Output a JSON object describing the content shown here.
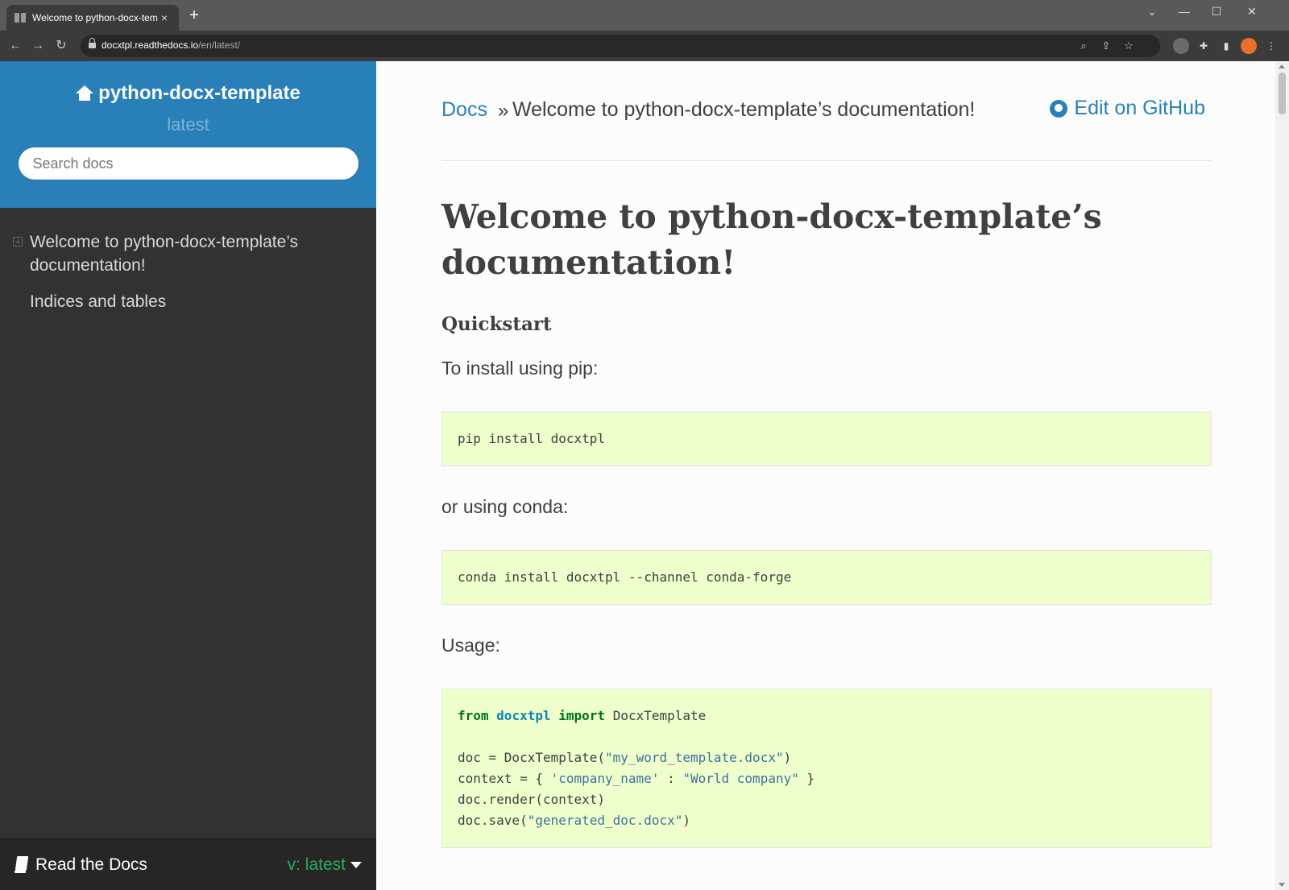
{
  "browser": {
    "tab_title": "Welcome to python-docx-templ",
    "tab_close": "×",
    "new_tab": "+",
    "url_domain": "docxtpl.readthedocs.io",
    "url_path": "/en/latest/",
    "controls": {
      "minimize": "—",
      "maximize": "☐",
      "close": "✕",
      "chevron": "⌄"
    },
    "nav": {
      "back": "←",
      "forward": "→",
      "reload": "↻"
    }
  },
  "sidebar": {
    "project_title": "python-docx-template",
    "version": "latest",
    "search_placeholder": "Search docs",
    "toc": [
      {
        "label": "Welcome to python-docx-template’s documentation!"
      },
      {
        "label": "Indices and tables"
      }
    ],
    "rtd_label": "Read the Docs",
    "rtd_version": "v: latest"
  },
  "breadcrumbs": {
    "docs": "Docs",
    "separator": "»",
    "current": "Welcome to python-docx-template’s documentation!",
    "edit": "Edit on GitHub"
  },
  "page": {
    "title": "Welcome to python-docx-template’s documentation!",
    "quickstart": "Quickstart",
    "install_pip_text": "To install using pip:",
    "pip_cmd": "pip install docxtpl",
    "install_conda_text": "or using conda:",
    "conda_cmd": "conda install docxtpl --channel conda-forge",
    "usage_text": "Usage:",
    "usage_code": {
      "l1_from": "from",
      "l1_module": "docxtpl",
      "l1_import": "import",
      "l1_name": "DocxTemplate",
      "l3_a": "doc = DocxTemplate(",
      "l3_str": "\"my_word_template.docx\"",
      "l3_b": ")",
      "l4_a": "context = { ",
      "l4_key": "'company_name'",
      "l4_b": " : ",
      "l4_val": "\"World company\"",
      "l4_c": " }",
      "l5": "doc.render(context)",
      "l6_a": "doc.save(",
      "l6_str": "\"generated_doc.docx\"",
      "l6_b": ")"
    }
  },
  "colors": {
    "sidebar_top": "#2980b9",
    "sidebar_bg": "#343131",
    "link": "#2980b9",
    "code_bg": "#eeffcc",
    "rtd_version": "#27ae60"
  }
}
